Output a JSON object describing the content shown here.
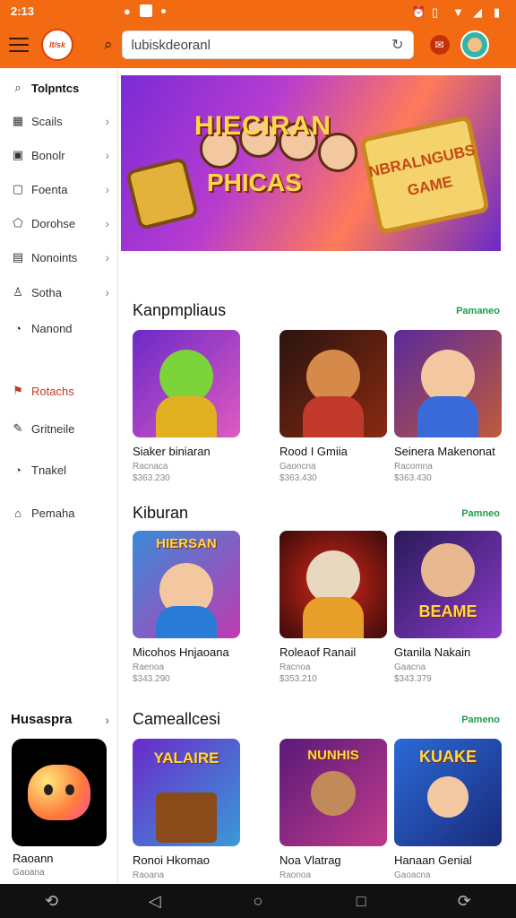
{
  "status_bar": {
    "time": "2:13"
  },
  "app_bar": {
    "logo_text": "lt/sk",
    "search_text": "lubiskdeoranl"
  },
  "sidebar": {
    "items": [
      {
        "label": "Tolpntcs",
        "icon": "search-icon"
      },
      {
        "label": "Scails",
        "icon": "grid-icon"
      },
      {
        "label": "Bonolr",
        "icon": "box-icon"
      },
      {
        "label": "Foenta",
        "icon": "document-icon"
      },
      {
        "label": "Dorohse",
        "icon": "shape-icon"
      },
      {
        "label": "Nonoints",
        "icon": "doc-icon"
      },
      {
        "label": "Sotha",
        "icon": "user-icon"
      },
      {
        "label": "Nanond",
        "icon": "clock-icon"
      },
      {
        "label": "Rotachs",
        "icon": "flag-icon"
      },
      {
        "label": "Gritneile",
        "icon": "pencil-icon"
      },
      {
        "label": "Tnakel",
        "icon": "clock-icon"
      },
      {
        "label": "Pemaha",
        "icon": "store-icon"
      }
    ],
    "section_title": "Husaspra",
    "card": {
      "title": "Raoann",
      "sub": "Gaoana"
    }
  },
  "hero": {
    "line1": "HIECIRAN",
    "line2": "PHICAS",
    "line3": "NBRALNGUBS",
    "line4": "GAME"
  },
  "sections": [
    {
      "title": "Kanpmpliaus",
      "more": "Pamaneo",
      "cards": [
        {
          "title": "Siaker biniaran",
          "sub": "Racnaca",
          "price": "$363.230"
        },
        {
          "title": "Rood I Gmiia",
          "sub": "Gaoncna",
          "price": "$363.430"
        },
        {
          "title": "Seinera Makenonat",
          "sub": "Racomna",
          "price": "$363.430"
        }
      ]
    },
    {
      "title": "Kiburan",
      "more": "Pamneo",
      "cards": [
        {
          "title": "Micohos Hnjaoana",
          "sub": "Raenoa",
          "price": "$343.290"
        },
        {
          "title": "Roleaof Ranail",
          "sub": "Racnoa",
          "price": "$353.210"
        },
        {
          "title": "Gtanila Nakain",
          "sub": "Gaacna",
          "price": "$343.379"
        }
      ]
    },
    {
      "title": "Cameallcesi",
      "more": "Pameno",
      "cards": [
        {
          "title": "Ronoi Hkomao",
          "sub": "Raoana",
          "price": ""
        },
        {
          "title": "Noa Vlatrag",
          "sub": "Raonoa",
          "price": ""
        },
        {
          "title": "Hanaan Genial",
          "sub": "Gaoacna",
          "price": ""
        }
      ]
    }
  ],
  "card_art": {
    "s0c0": "",
    "s0c1": "",
    "s0c2": "",
    "s1c0": "HIERSAN",
    "s1c1": "",
    "s1c2": "BEAME",
    "s2c0": "YALAIRE",
    "s2c1": "NUNHIS",
    "s2c2": "KUAKE"
  }
}
